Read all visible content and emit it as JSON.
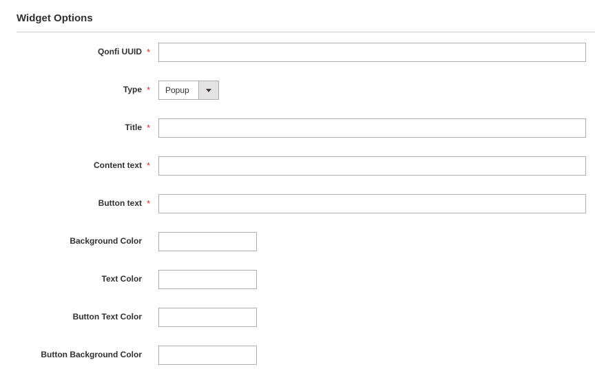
{
  "section": {
    "title": "Widget Options"
  },
  "fields": {
    "qonfi_uuid": {
      "label": "Qonfi UUID",
      "required": true,
      "value": ""
    },
    "type": {
      "label": "Type",
      "required": true,
      "selected": "Popup"
    },
    "title": {
      "label": "Title",
      "required": true,
      "value": ""
    },
    "content_text": {
      "label": "Content text",
      "required": true,
      "value": ""
    },
    "button_text": {
      "label": "Button text",
      "required": true,
      "value": ""
    },
    "background_color": {
      "label": "Background Color",
      "required": false,
      "value": ""
    },
    "text_color": {
      "label": "Text Color",
      "required": false,
      "value": ""
    },
    "button_text_color": {
      "label": "Button Text Color",
      "required": false,
      "value": ""
    },
    "button_background_color": {
      "label": "Button Background Color",
      "required": false,
      "value": ""
    }
  },
  "required_marker": "*",
  "colors": {
    "required": "#e02b27",
    "input_border": "#adadad",
    "select_arrow_bg": "#e3e3e3",
    "divider": "#cccccc",
    "text": "#303030"
  },
  "icons": {
    "select_arrow": "caret-down-icon"
  }
}
